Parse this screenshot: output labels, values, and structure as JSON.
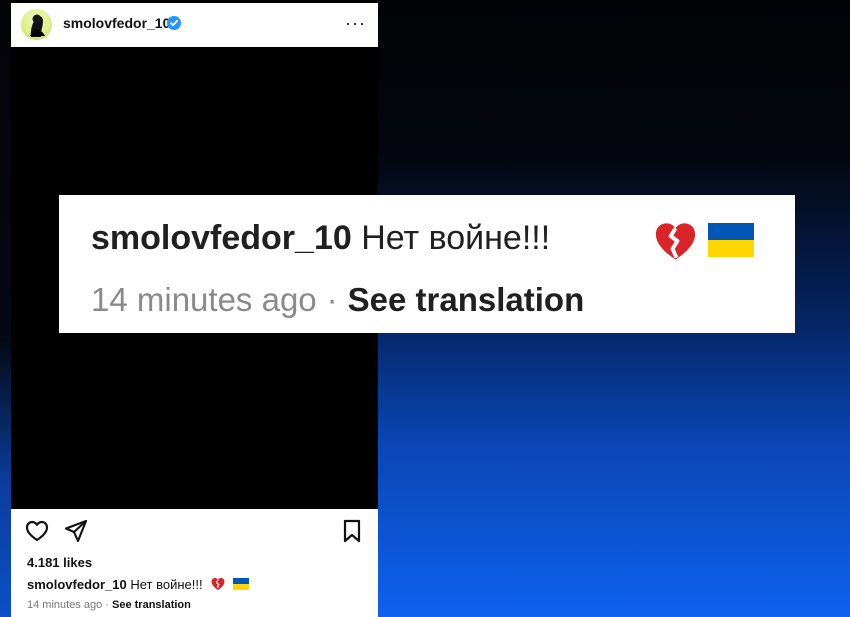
{
  "post": {
    "username": "smolovfedor_10",
    "verified_icon": "verified-badge-icon",
    "more_icon": "more-options-icon",
    "more_label": "···",
    "avatar_icon": "profile-avatar"
  },
  "zoomed_caption": {
    "username": "smolovfedor_10",
    "text": "Нет войне!!!",
    "emoji_1": "broken-heart-icon",
    "emoji_2": "ukraine-flag-icon",
    "time": "14 minutes ago",
    "separator": "·",
    "translation": "See translation"
  },
  "actions": {
    "like_icon": "heart-icon",
    "share_icon": "send-icon",
    "save_icon": "bookmark-icon"
  },
  "stats": {
    "likes": "4.181 likes"
  },
  "caption": {
    "username": "smolovfedor_10",
    "text": "Нет войне!!!",
    "time": "14 minutes ago",
    "separator": "·",
    "translation": "See translation"
  },
  "colors": {
    "background_top": "#020305",
    "background_bottom": "#0f61ee",
    "ukraine_blue": "#0057b7",
    "ukraine_yellow": "#ffd700",
    "broken_heart_red": "#d9252a"
  }
}
